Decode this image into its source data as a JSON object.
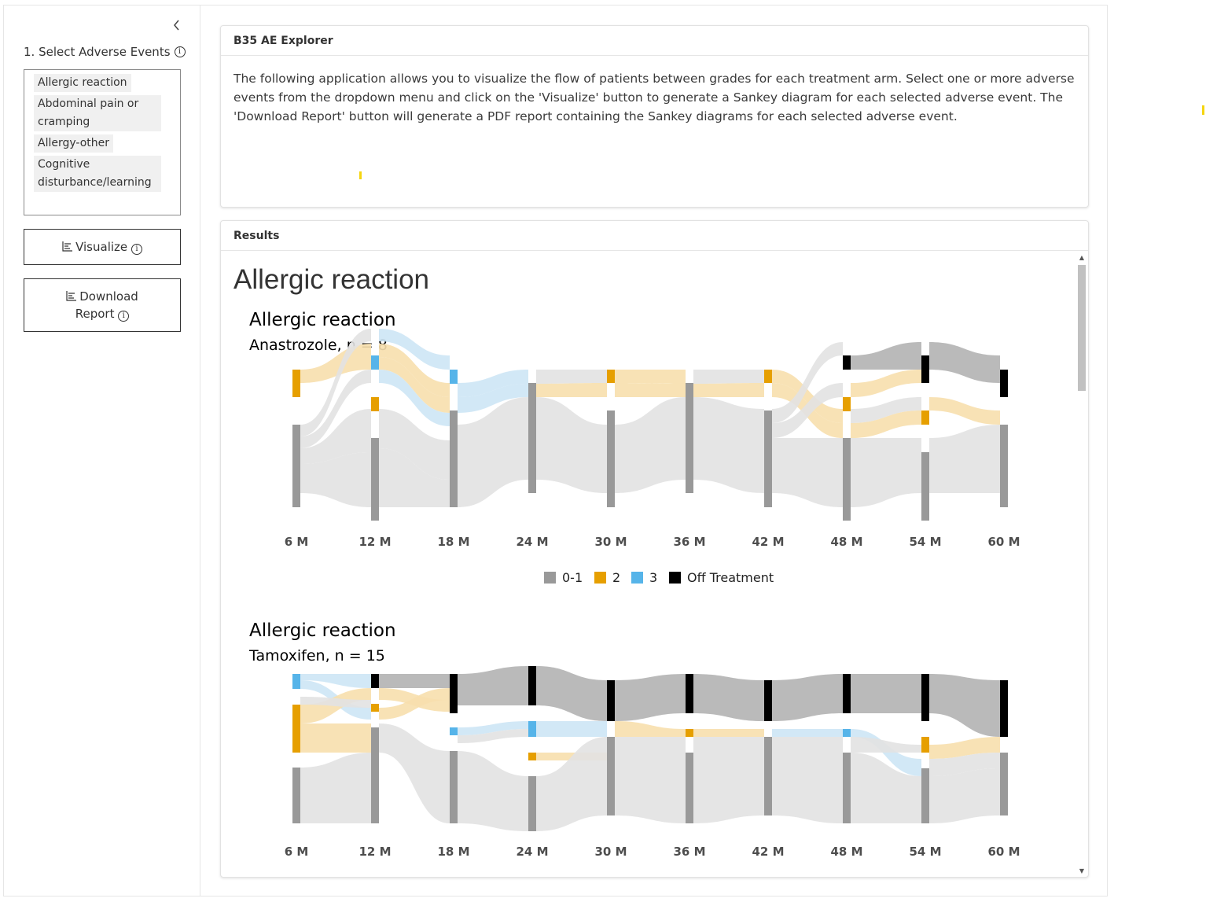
{
  "sidebar": {
    "field_label": "1. Select Adverse Events",
    "selected_events": [
      "Allergic reaction",
      "Abdominal pain or cramping",
      "Allergy-other",
      "Cognitive disturbance/learning"
    ],
    "visualize_label": "Visualize",
    "download_label": "Download Report"
  },
  "intro": {
    "title": "B35 AE Explorer",
    "text": "The following application allows you to visualize the flow of patients between grades for each treatment arm. Select one or more adverse events from the dropdown menu and click on the 'Visualize' button to generate a Sankey diagram for each selected adverse event. The 'Download Report' button will generate a PDF report containing the Sankey diagrams for each selected adverse event."
  },
  "results": {
    "header": "Results",
    "title": "Allergic reaction",
    "time_points": [
      "6 M",
      "12 M",
      "18 M",
      "24 M",
      "30 M",
      "36 M",
      "42 M",
      "48 M",
      "54 M",
      "60 M"
    ],
    "legend": [
      {
        "label": "0-1",
        "color": "#999999"
      },
      {
        "label": "2",
        "color": "#E69F00"
      },
      {
        "label": "3",
        "color": "#56B4E9"
      },
      {
        "label": "Off Treatment",
        "color": "#000000"
      }
    ],
    "charts": [
      {
        "title": "Allergic reaction",
        "subtitle": "Anastrozole, n = 8"
      },
      {
        "title": "Allergic reaction",
        "subtitle": "Tamoxifen, n = 15"
      }
    ]
  },
  "colors": {
    "grade01": "#999999",
    "grade2": "#E69F00",
    "grade3": "#56B4E9",
    "off": "#000000"
  }
}
